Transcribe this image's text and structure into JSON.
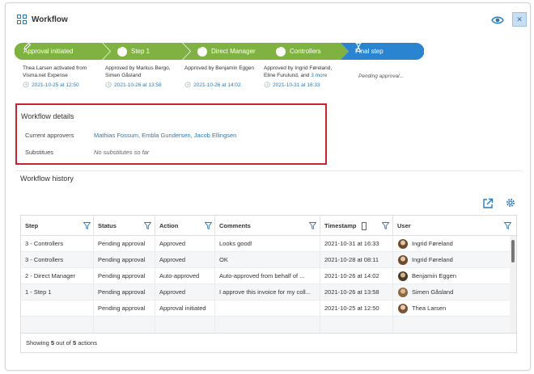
{
  "window": {
    "title": "Workflow"
  },
  "colors": {
    "done": "#7fb241",
    "current": "#2b84cf",
    "link": "#2a7ab9",
    "highlight": "#c9242f"
  },
  "steps": [
    {
      "label": "Approval initiated",
      "status": "done",
      "icon": "pencil-icon",
      "info": [
        "Thea Larsen activated from",
        "Visma.net Expense"
      ],
      "more": "",
      "timestamp": "2021-10-25 at 12:50"
    },
    {
      "label": "Step 1",
      "status": "done",
      "icon": "check-circle-icon",
      "info": [
        "Approved by Markus Bergo,",
        "Simen Gåsland"
      ],
      "more": "",
      "timestamp": "2021-10-26 at 13:58"
    },
    {
      "label": "Direct Manager",
      "status": "done",
      "icon": "check-circle-icon",
      "info": [
        "Approved by Benjamin Eggen"
      ],
      "more": "",
      "timestamp": "2021-10-26 at 14:02"
    },
    {
      "label": "Controllers",
      "status": "done",
      "icon": "check-circle-icon",
      "info": [
        "Approved by Ingrid Føreland,",
        "Eline Furulund, and"
      ],
      "more": "3 more",
      "timestamp": "2021-10-31 at 16:33"
    },
    {
      "label": "Final step",
      "status": "current",
      "icon": "hourglass-icon",
      "info": [
        "Pending approval..."
      ],
      "more": "",
      "timestamp": ""
    }
  ],
  "details": {
    "heading": "Workflow details",
    "approvers_label": "Current approvers",
    "approvers_value": "Mathias Fossum, Embla Gundersen, Jacob Ellingsen",
    "substitutes_label": "Substitues",
    "substitutes_value": "No substitutes so far"
  },
  "history": {
    "heading": "Workflow history",
    "columns": [
      "Step",
      "Status",
      "Action",
      "Comments",
      "Timestamp",
      "User"
    ],
    "rows": [
      {
        "step": "3 - Controllers",
        "status": "Pending approval",
        "action": "Approved",
        "comments": "Looks good!",
        "timestamp": "2021-10-31 at 16:33",
        "user": "Ingrid Føreland"
      },
      {
        "step": "3 - Controllers",
        "status": "Pending approval",
        "action": "Approved",
        "comments": "OK",
        "timestamp": "2021-10-28 at 08:11",
        "user": "Ingrid Føreland"
      },
      {
        "step": "2 - Direct Manager",
        "status": "Pending approval",
        "action": "Auto-approved",
        "comments": "Auto-approved from behalf of ...",
        "timestamp": "2021-10-26 at 14:02",
        "user": "Benjamin Eggen"
      },
      {
        "step": "1 - Step 1",
        "status": "Pending approval",
        "action": "Approved",
        "comments": "I approve this invoice for my coll...",
        "timestamp": "2021-10-26 at 13:58",
        "user": "Simen Gåsland"
      },
      {
        "step": "",
        "status": "Pending approval",
        "action": "Approval initiated",
        "comments": "",
        "timestamp": "2021-10-25 at 12:50",
        "user": "Thea Larsen"
      }
    ],
    "footer_prefix": "Showing ",
    "footer_shown": "5",
    "footer_mid": " out of ",
    "footer_total": "5",
    "footer_suffix": " actions"
  }
}
